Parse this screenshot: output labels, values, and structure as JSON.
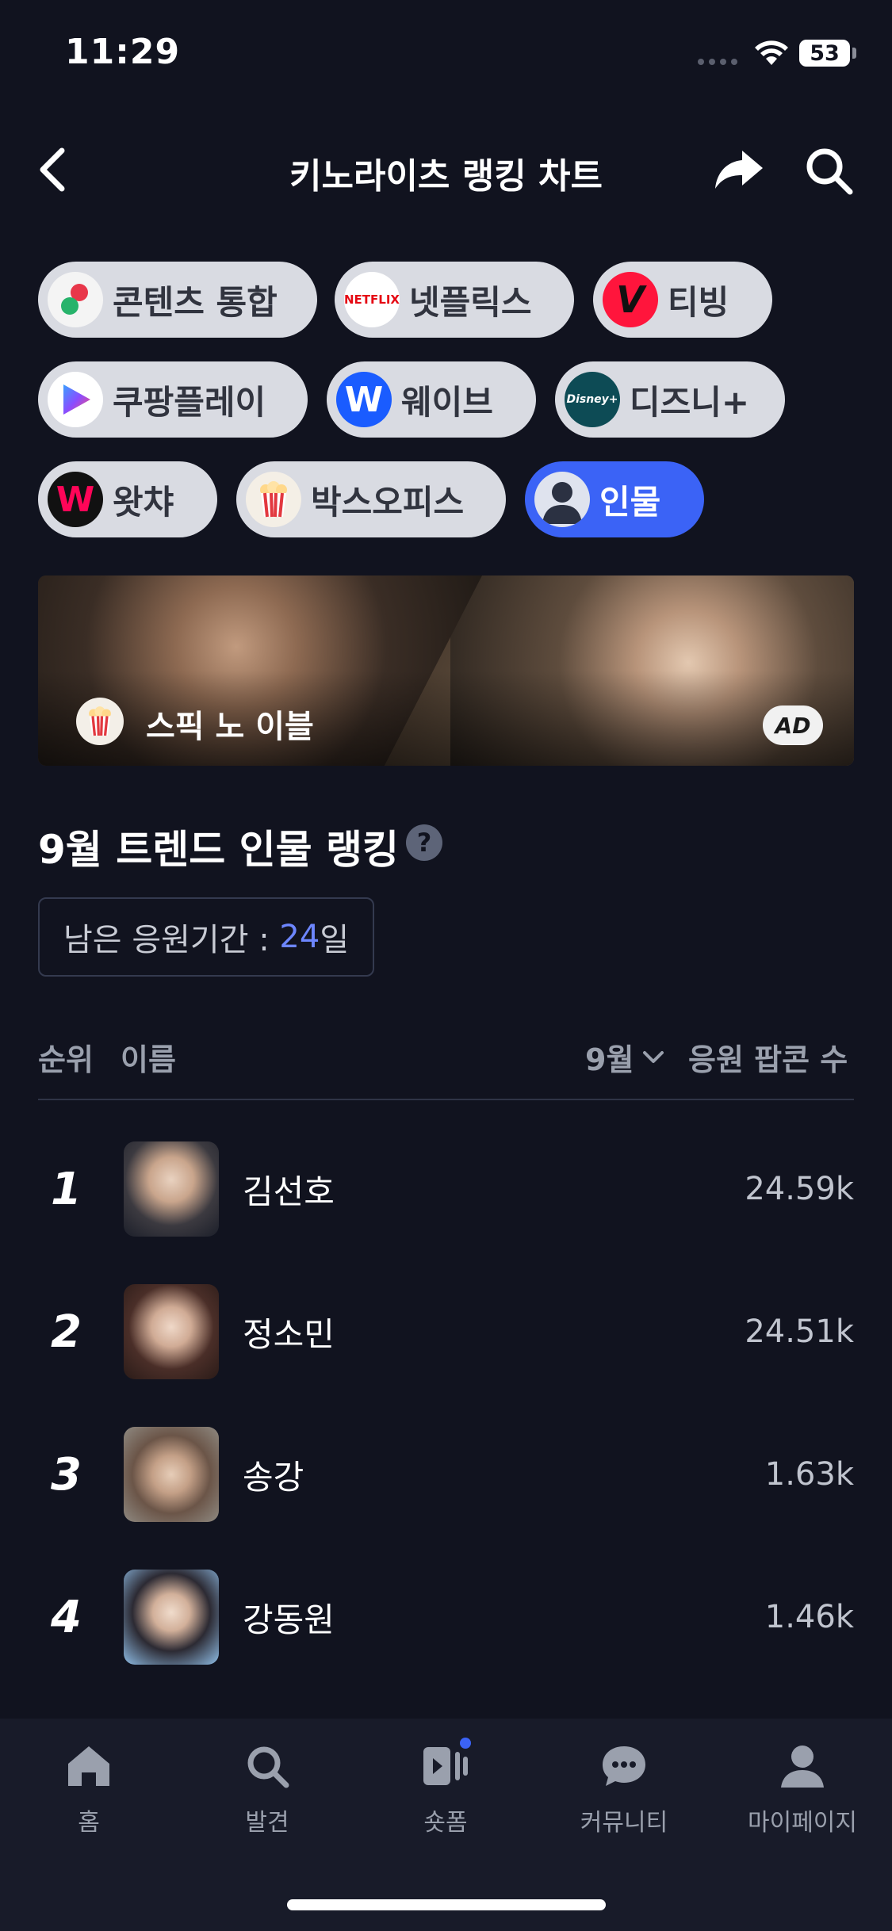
{
  "status_bar": {
    "time": "11:29",
    "battery": "53"
  },
  "header": {
    "title": "키노라이츠 랭킹 차트"
  },
  "filters": [
    {
      "label": "콘텐츠 통합",
      "icon": "contents-logo-icon"
    },
    {
      "label": "넷플릭스",
      "icon": "netflix-logo-icon",
      "logo_text": "NETFLIX"
    },
    {
      "label": "티빙",
      "icon": "tving-logo-icon",
      "logo_text": "V"
    },
    {
      "label": "쿠팡플레이",
      "icon": "coupangplay-logo-icon"
    },
    {
      "label": "웨이브",
      "icon": "wavve-logo-icon",
      "logo_text": "W"
    },
    {
      "label": "디즈니+",
      "icon": "disneyplus-logo-icon",
      "logo_text": "Disney+"
    },
    {
      "label": "왓챠",
      "icon": "watcha-logo-icon",
      "logo_text": "W"
    },
    {
      "label": "박스오피스",
      "icon": "popcorn-icon"
    },
    {
      "label": "인물",
      "icon": "person-icon",
      "active": true
    }
  ],
  "ad_banner": {
    "title": "스픽 노 이블",
    "badge": "AD"
  },
  "section": {
    "title": "9월 트렌드 인물 랭킹",
    "help": "?",
    "period_label": "남은 응원기간 : ",
    "period_days": "24",
    "period_unit": "일"
  },
  "table": {
    "col_rank": "순위",
    "col_name": "이름",
    "month_selector": "9월",
    "col_metric": "응원 팝콘 수",
    "rows": [
      {
        "rank": "1",
        "name": "김선호",
        "score": "24.59k"
      },
      {
        "rank": "2",
        "name": "정소민",
        "score": "24.51k"
      },
      {
        "rank": "3",
        "name": "송강",
        "score": "1.63k"
      },
      {
        "rank": "4",
        "name": "강동원",
        "score": "1.46k"
      }
    ]
  },
  "bottom_nav": [
    {
      "label": "홈",
      "icon": "home-icon"
    },
    {
      "label": "발견",
      "icon": "search-icon"
    },
    {
      "label": "숏폼",
      "icon": "shortform-icon",
      "has_dot": true
    },
    {
      "label": "커뮤니티",
      "icon": "chat-bubble-icon"
    },
    {
      "label": "마이페이지",
      "icon": "profile-icon"
    }
  ],
  "colors": {
    "background": "#11131f",
    "accent": "#3b63f6",
    "chip": "#d9dbe2",
    "highlight_number": "#6d86ff"
  }
}
